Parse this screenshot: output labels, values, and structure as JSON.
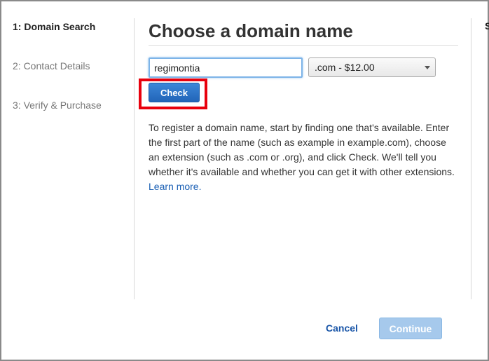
{
  "steps": [
    {
      "label": "1: Domain Search",
      "active": true
    },
    {
      "label": "2: Contact Details",
      "active": false
    },
    {
      "label": "3: Verify & Purchase",
      "active": false
    }
  ],
  "edge_glyph": "S",
  "main": {
    "title": "Choose a domain name",
    "domain_input": {
      "value": "regimontia",
      "placeholder": ""
    },
    "tld_select": {
      "selected": ".com - $12.00"
    },
    "check_label": "Check",
    "help_text": "To register a domain name, start by finding one that's available. Enter the first part of the name (such as example in example.com), choose an extension (such as .com or .org), and click Check. We'll tell you whether it's available and whether you can get it with other extensions.",
    "learn_more": "Learn more."
  },
  "footer": {
    "cancel_label": "Cancel",
    "continue_label": "Continue"
  },
  "colors": {
    "primary_button": "#2a70c4",
    "disabled_button": "#a6c9ec",
    "link": "#1a56a8",
    "highlight_box": "#e8000d"
  },
  "icons": {
    "select_caret": "caret-down-icon"
  }
}
